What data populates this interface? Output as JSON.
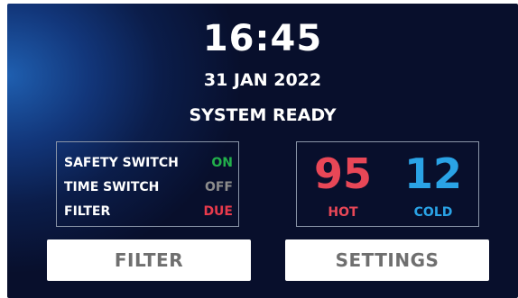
{
  "clock": {
    "time": "16:45",
    "date": "31 JAN 2022"
  },
  "system": {
    "status": "SYSTEM READY"
  },
  "switches": [
    {
      "label": "SAFETY SWITCH",
      "value": "ON",
      "color": "#22b04b"
    },
    {
      "label": "TIME SWITCH",
      "value": "OFF",
      "color": "#8c8c8c"
    },
    {
      "label": "FILTER",
      "value": "DUE",
      "color": "#e83a4c"
    }
  ],
  "temperatures": {
    "hot": {
      "value": "95",
      "label": "HOT",
      "color": "#e84757"
    },
    "cold": {
      "value": "12",
      "label": "COLD",
      "color": "#2aa3e6"
    }
  },
  "buttons": {
    "filter_label": "FILTER",
    "settings_label": "SETTINGS"
  },
  "colors": {
    "background": "#080f2c",
    "accent_blue": "#1f5fb0",
    "text": "#ffffff"
  }
}
